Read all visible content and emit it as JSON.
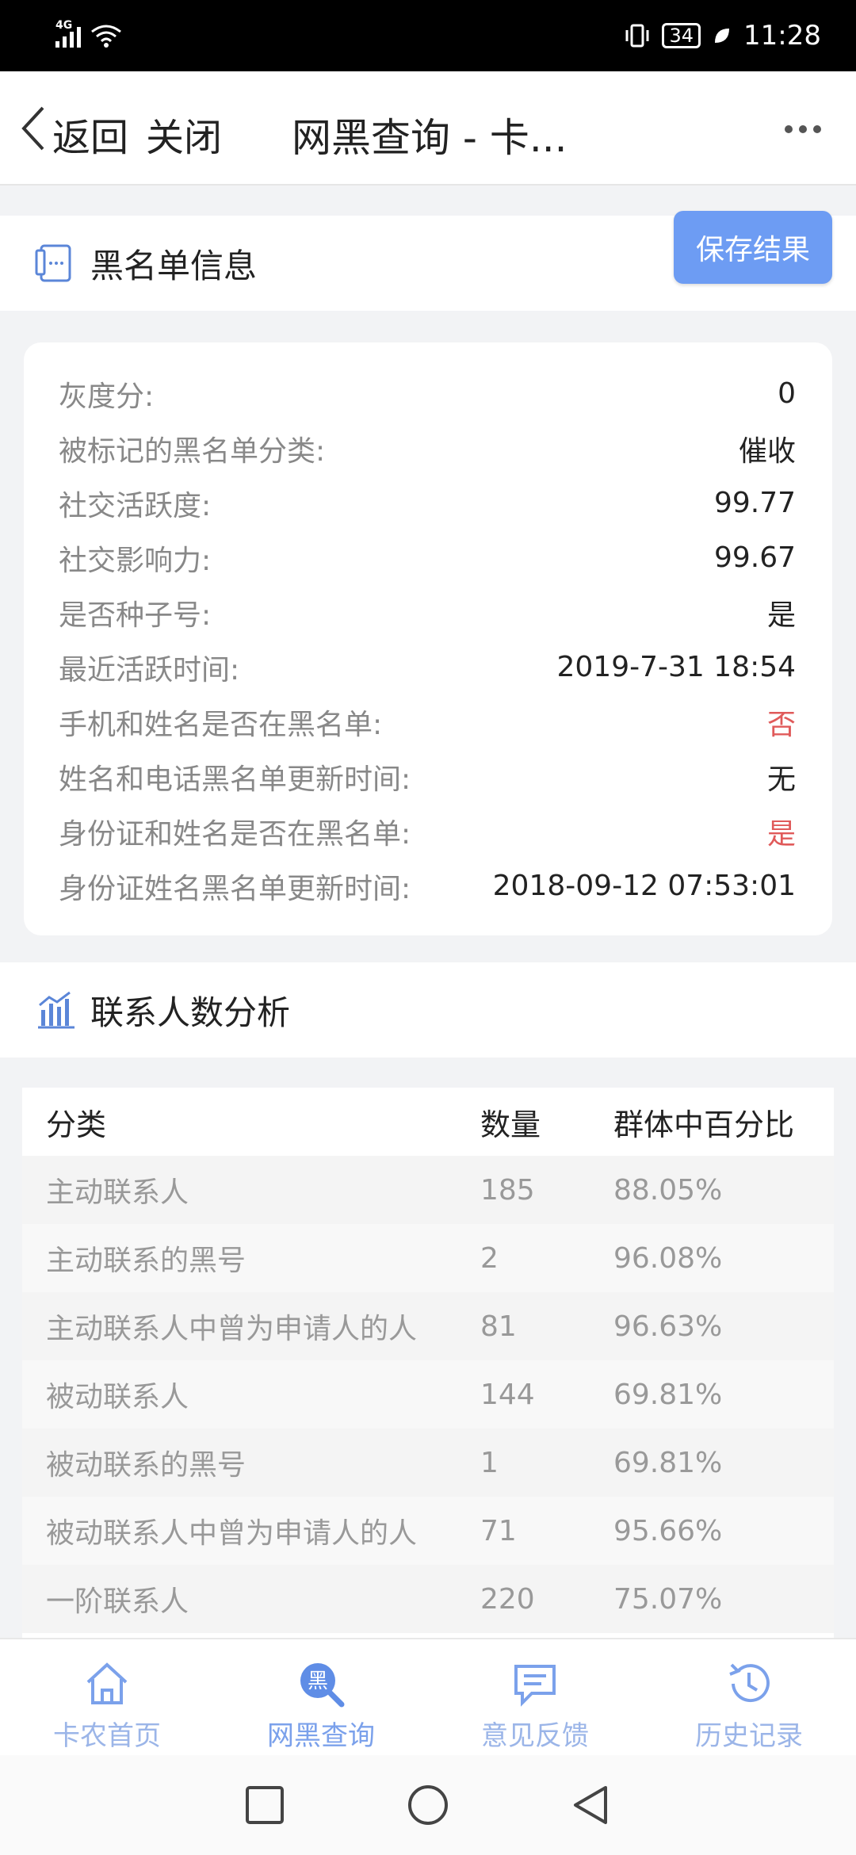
{
  "status_bar": {
    "network": "4G",
    "battery": "34",
    "time": "11:28"
  },
  "title_bar": {
    "back_label": "返回",
    "close_label": "关闭",
    "title": "网黑查询 - 卡..."
  },
  "blacklist_section": {
    "title": "黑名单信息",
    "save_label": "保存结果"
  },
  "blacklist_info": [
    {
      "label": "灰度分:",
      "value": "0",
      "highlight": false
    },
    {
      "label": "被标记的黑名单分类:",
      "value": "催收",
      "highlight": false
    },
    {
      "label": "社交活跃度:",
      "value": "99.77",
      "highlight": false
    },
    {
      "label": "社交影响力:",
      "value": "99.67",
      "highlight": false
    },
    {
      "label": "是否种子号:",
      "value": "是",
      "highlight": false
    },
    {
      "label": "最近活跃时间:",
      "value": "2019-7-31 18:54",
      "highlight": false
    },
    {
      "label": "手机和姓名是否在黑名单:",
      "value": "否",
      "highlight": true
    },
    {
      "label": "姓名和电话黑名单更新时间:",
      "value": "无",
      "highlight": false
    },
    {
      "label": "身份证和姓名是否在黑名单:",
      "value": "是",
      "highlight": true
    },
    {
      "label": "身份证姓名黑名单更新时间:",
      "value": "2018-09-12 07:53:01",
      "highlight": false
    }
  ],
  "contacts_section": {
    "title": "联系人数分析"
  },
  "contacts_table": {
    "headers": [
      "分类",
      "数量",
      "群体中百分比"
    ],
    "rows": [
      [
        "主动联系人",
        "185",
        "88.05%"
      ],
      [
        "主动联系的黑号",
        "2",
        "96.08%"
      ],
      [
        "主动联系人中曾为申请人的人",
        "81",
        "96.63%"
      ],
      [
        "被动联系人",
        "144",
        "69.81%"
      ],
      [
        "被动联系的黑号",
        "1",
        "69.81%"
      ],
      [
        "被动联系人中曾为申请人的人",
        "71",
        "95.66%"
      ],
      [
        "一阶联系人",
        "220",
        "75.07%"
      ]
    ]
  },
  "bottom_nav": [
    {
      "label": "卡农首页",
      "icon": "home-icon"
    },
    {
      "label": "网黑查询",
      "icon": "blacklist-search-icon",
      "icon_text": "黑"
    },
    {
      "label": "意见反馈",
      "icon": "feedback-icon"
    },
    {
      "label": "历史记录",
      "icon": "history-icon"
    }
  ],
  "colors": {
    "accent": "#6d9cf3",
    "alert": "#e05a5a",
    "nav": "#9bb5e8"
  }
}
